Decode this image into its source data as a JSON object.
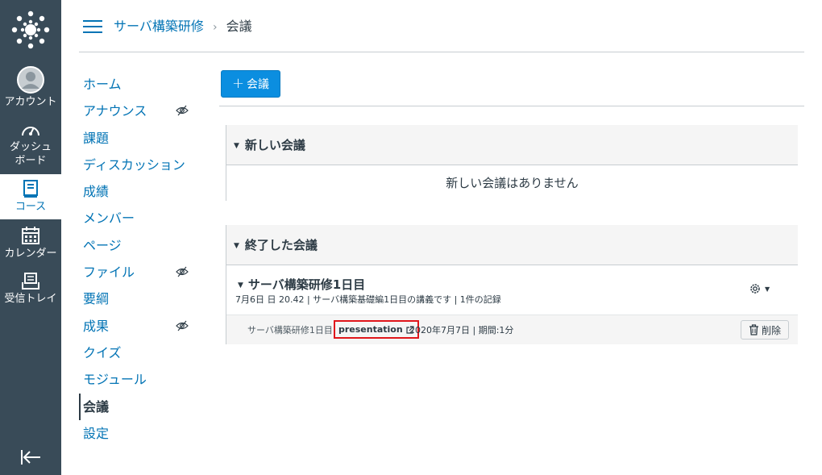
{
  "global_nav": {
    "account_label": "アカウント",
    "dashboard_label": "ダッシュ\nボード",
    "dashboard_line1": "ダッシュ",
    "dashboard_line2": "ボード",
    "courses_label": "コース",
    "calendar_label": "カレンダー",
    "inbox_label": "受信トレイ",
    "bg_color": "#394b58",
    "active_color": "#0374b5"
  },
  "header": {
    "course_name": "サーバ構築研修",
    "current_page": "会議",
    "separator": "›"
  },
  "course_nav": {
    "items": [
      {
        "label": "ホーム",
        "hidden": false
      },
      {
        "label": "アナウンス",
        "hidden": true
      },
      {
        "label": "課題",
        "hidden": false
      },
      {
        "label": "ディスカッション",
        "hidden": false
      },
      {
        "label": "成績",
        "hidden": false
      },
      {
        "label": "メンバー",
        "hidden": false
      },
      {
        "label": "ページ",
        "hidden": false
      },
      {
        "label": "ファイル",
        "hidden": true
      },
      {
        "label": "要綱",
        "hidden": false
      },
      {
        "label": "成果",
        "hidden": true
      },
      {
        "label": "クイズ",
        "hidden": false
      },
      {
        "label": "モジュール",
        "hidden": false
      },
      {
        "label": "会議",
        "hidden": false,
        "active": true
      },
      {
        "label": "設定",
        "hidden": false
      }
    ]
  },
  "main": {
    "add_button_label": "会議",
    "add_button_icon": "+",
    "new_section": {
      "title": "新しい会議",
      "empty_message": "新しい会議はありません"
    },
    "concluded_section": {
      "title": "終了した会議",
      "conference": {
        "title": "サーバ構築研修1日目",
        "meta": "7月6日 日 20.42 | サーバ構築基礎編1日目の講義です | 1件の記録",
        "recording": {
          "name": "サーバ構築研修1日目",
          "link_label": "presentation",
          "date_info": "2020年7月7日 | 期間:1分",
          "delete_label": "削除"
        }
      }
    },
    "accent_color": "#0b8ee0",
    "highlight_color": "#e0161b"
  }
}
